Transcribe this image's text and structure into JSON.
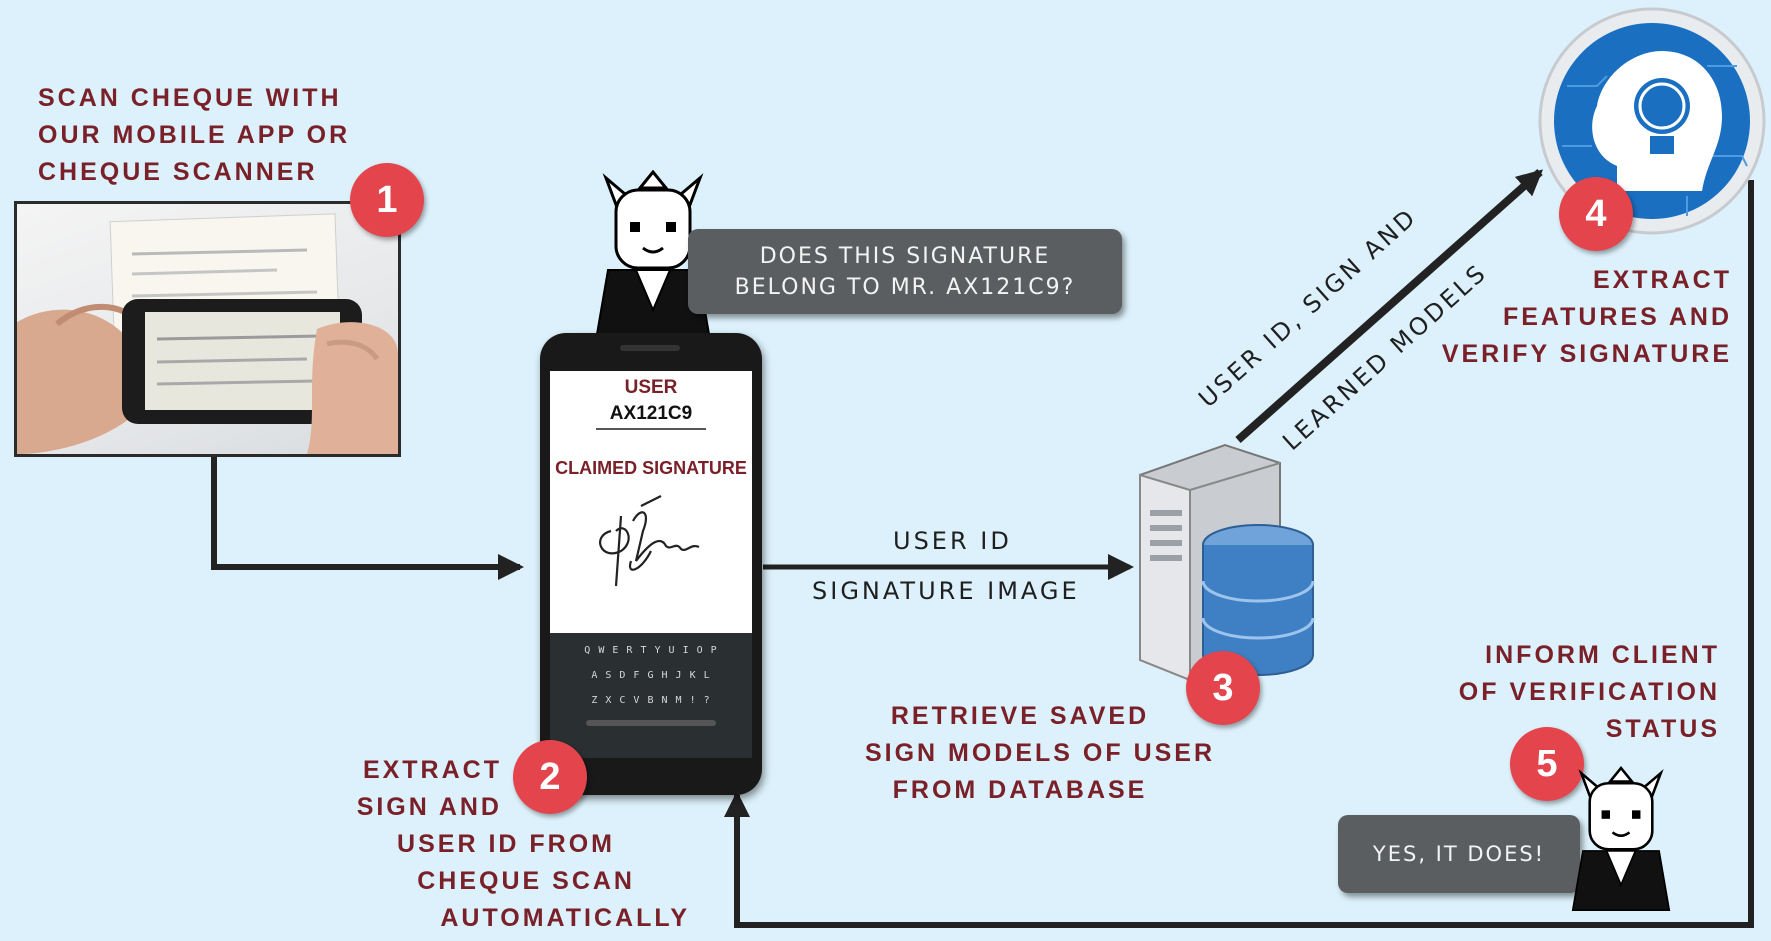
{
  "steps": {
    "step1": {
      "number": "1",
      "lines": [
        "SCAN CHEQUE WITH",
        "OUR MOBILE APP OR",
        "CHEQUE SCANNER"
      ]
    },
    "step2": {
      "number": "2",
      "lines": [
        "EXTRACT",
        "SIGN AND",
        "USER ID FROM",
        "CHEQUE SCAN",
        "AUTOMATICALLY"
      ]
    },
    "step3": {
      "number": "3",
      "lines": [
        "RETRIEVE SAVED",
        "SIGN MODELS OF USER",
        "FROM DATABASE"
      ]
    },
    "step4": {
      "number": "4",
      "lines": [
        "EXTRACT",
        "FEATURES AND",
        "VERIFY SIGNATURE"
      ]
    },
    "step5": {
      "number": "5",
      "lines": [
        "INFORM CLIENT",
        "OF VERIFICATION",
        "STATUS"
      ]
    }
  },
  "bubbles": {
    "question": [
      "DOES THIS SIGNATURE",
      "BELONG TO MR. AX121C9?"
    ],
    "answer": "YES, IT DOES!"
  },
  "phone_screen": {
    "user_label": "USER",
    "user_id": "AX121C9",
    "claimed_label": "CLAIMED SIGNATURE",
    "keyboard_rows": [
      "Q W E R T Y U I O P",
      "A S D F G H J K L",
      "Z X C V B N M ! ?"
    ]
  },
  "flow_labels": {
    "to_server": [
      "USER ID",
      "SIGNATURE IMAGE"
    ],
    "to_ai": [
      "USER ID, SIGN AND",
      "LEARNED MODELS"
    ]
  },
  "colors": {
    "background": "#dcf1fb",
    "step_text": "#7a2028",
    "badge": "#e4454d",
    "arrow": "#222222",
    "bubble": "#5b5e60"
  }
}
